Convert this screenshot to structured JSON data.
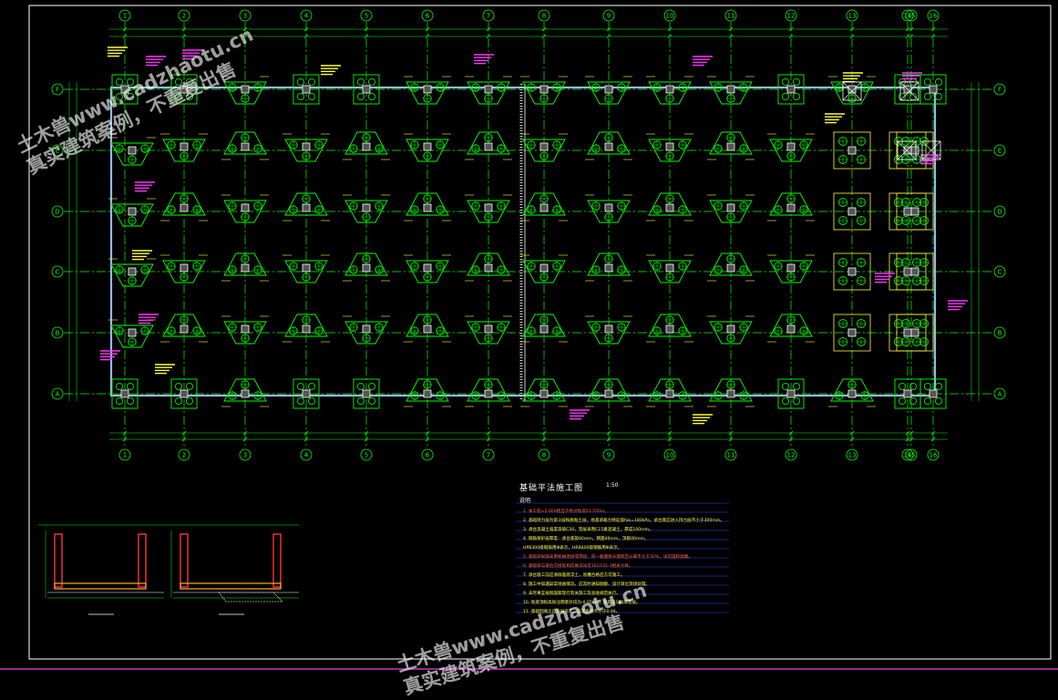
{
  "drawing": {
    "grid_columns": [
      "1",
      "2",
      "3",
      "4",
      "5",
      "6",
      "7",
      "8",
      "9",
      "10",
      "11",
      "12",
      "13",
      "14",
      "15",
      "16"
    ],
    "grid_rows": [
      "F",
      "E",
      "D",
      "C",
      "B",
      "A"
    ],
    "title": "基础平法施工图",
    "scale": "1:50",
    "notes_heading": "说明",
    "notes": [
      "1. 本工程±0.000相当于绝对标高51.550m。",
      "2. 基础持力层为第②层粉质粘土层，地基承载力特征值fak=180kPa，承台底应进入持力层不小于300mm。",
      "3. 承台混凝土强度等级C30，垫层采用C15素混凝土，厚度100mm。",
      "4. 钢筋保护层厚度：承台底部40mm，侧面40mm，顶部40mm。",
      "   HPB300级钢筋用Φ表示，HRB400级钢筋用Φ表示。",
      "5. 基础梁纵筋采用机械连接或焊接，同一截面接头面积百分率不大于50%，详见国标图集。",
      "6. 基础梁与承台交接处构造做法详见16G101-3相关大样。",
      "7. 承台施工前应清除基底浮土，验槽合格后方可施工。",
      "8. 施工中如遇异常地质情况，应及时通知勘察、设计单位现场处理。",
      "9. 未尽事宜按照国家现行有关施工及验收规范执行。",
      "10. 地梁顶标高除注明者外均为-0.050m，梁底设100厚垫层。",
      "11. 基础回填土应分层夯实，压实系数不小于0.94。"
    ]
  },
  "watermarks": [
    {
      "line1": "土木兽www.cadzhaotu.cn",
      "line2": "真实建筑案例，不重复出售"
    },
    {
      "line1": "土木兽www.cadzhaotu.cn",
      "line2": "真实建筑案例，不重复出售"
    }
  ],
  "colors": {
    "background": "#000000",
    "grid_line": "#00ff00",
    "beam": "#9ab8e8",
    "pile_cap": "#00ff00",
    "pile": "#00ff00",
    "column": "#ffffff",
    "annotation_magenta": "#ff33ff",
    "annotation_yellow": "#ffff33",
    "dimension": "#00ff00",
    "wall_section": "#ff3333",
    "rebar_section": "#ffaa33",
    "border": "#ffffff",
    "bottom_line": "#cc33cc"
  }
}
